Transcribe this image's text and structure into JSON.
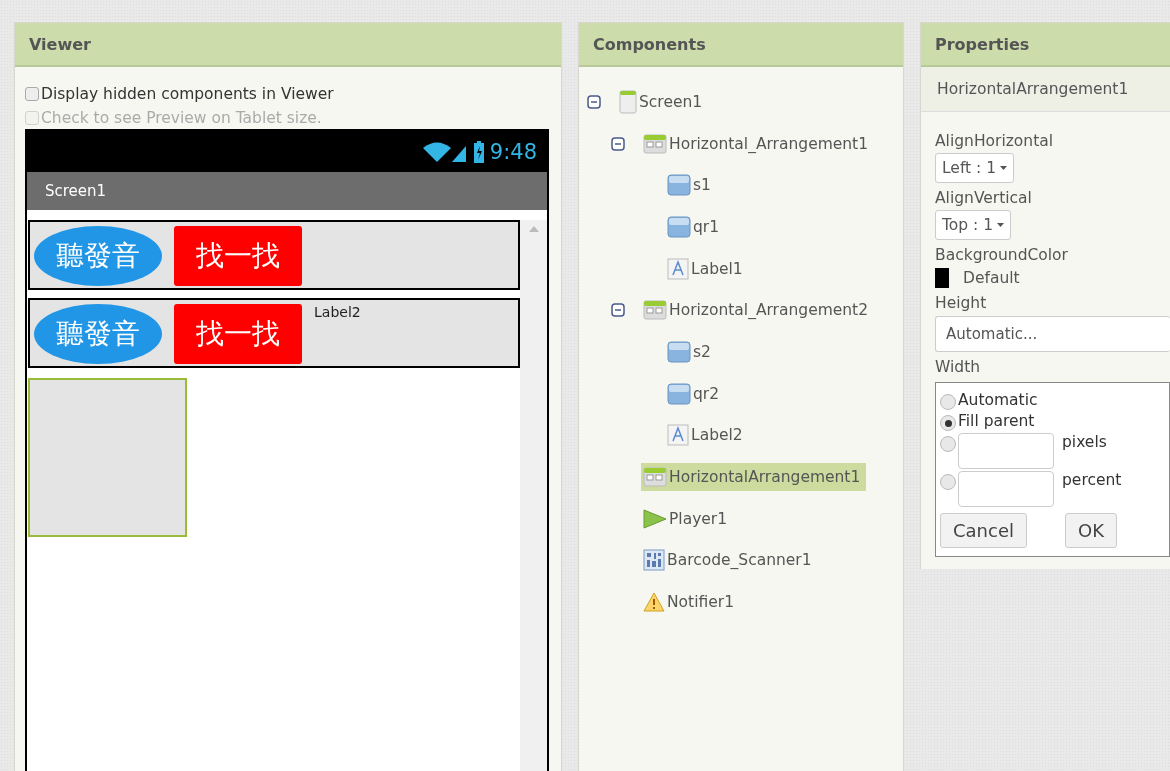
{
  "viewer": {
    "title": "Viewer",
    "options": [
      {
        "label": "Display hidden components in Viewer",
        "checked": false,
        "disabled": false
      },
      {
        "label": "Check to see Preview on Tablet size.",
        "checked": false,
        "disabled": true
      }
    ],
    "phone": {
      "time": "9:48",
      "screen_title": "Screen1",
      "arrangements": [
        {
          "selected": false,
          "items": [
            {
              "kind": "oval",
              "text": "聽發音"
            },
            {
              "kind": "rect",
              "text": "找一找"
            }
          ]
        },
        {
          "selected": false,
          "items": [
            {
              "kind": "oval",
              "text": "聽發音"
            },
            {
              "kind": "rect",
              "text": "找一找"
            },
            {
              "kind": "label",
              "text": "Label2"
            }
          ]
        },
        {
          "selected": true
        }
      ]
    }
  },
  "components": {
    "title": "Components",
    "tree": [
      {
        "kind": "screen",
        "label": "Screen1",
        "selected": false,
        "expanded": true,
        "children": [
          {
            "kind": "arrangement",
            "label": "Horizontal_Arrangement1",
            "selected": false,
            "expanded": true,
            "children": [
              {
                "kind": "image",
                "label": "s1",
                "selected": false
              },
              {
                "kind": "image",
                "label": "qr1",
                "selected": false
              },
              {
                "kind": "label",
                "label": "Label1",
                "selected": false
              }
            ]
          },
          {
            "kind": "arrangement",
            "label": "Horizontal_Arrangement2",
            "selected": false,
            "expanded": true,
            "children": [
              {
                "kind": "image",
                "label": "s2",
                "selected": false
              },
              {
                "kind": "image",
                "label": "qr2",
                "selected": false
              },
              {
                "kind": "label",
                "label": "Label2",
                "selected": false
              }
            ]
          },
          {
            "kind": "arrangement",
            "label": "HorizontalArrangement1",
            "selected": true
          },
          {
            "kind": "player",
            "label": "Player1",
            "selected": false
          },
          {
            "kind": "barcode",
            "label": "Barcode_Scanner1",
            "selected": false
          },
          {
            "kind": "notifier",
            "label": "Notifier1",
            "selected": false
          }
        ]
      }
    ]
  },
  "properties": {
    "title": "Properties",
    "component": "HorizontalArrangement1",
    "items": [
      {
        "kind": "dropdown",
        "label": "AlignHorizontal",
        "value": "Left : 1"
      },
      {
        "kind": "dropdown",
        "label": "AlignVertical",
        "value": "Top : 1"
      },
      {
        "kind": "color",
        "label": "BackgroundColor",
        "value": "Default",
        "color": "#000000"
      },
      {
        "kind": "text",
        "label": "Height",
        "value": "Automatic..."
      },
      {
        "kind": "size",
        "label": "Width",
        "options": [
          {
            "kind": "plain",
            "label": "Automatic",
            "selected": false
          },
          {
            "kind": "plain",
            "label": "Fill parent",
            "selected": true
          },
          {
            "kind": "input",
            "label": "pixels",
            "selected": false
          },
          {
            "kind": "input",
            "label": "percent",
            "selected": false
          }
        ],
        "buttons": [
          "Cancel",
          "OK"
        ]
      }
    ]
  }
}
